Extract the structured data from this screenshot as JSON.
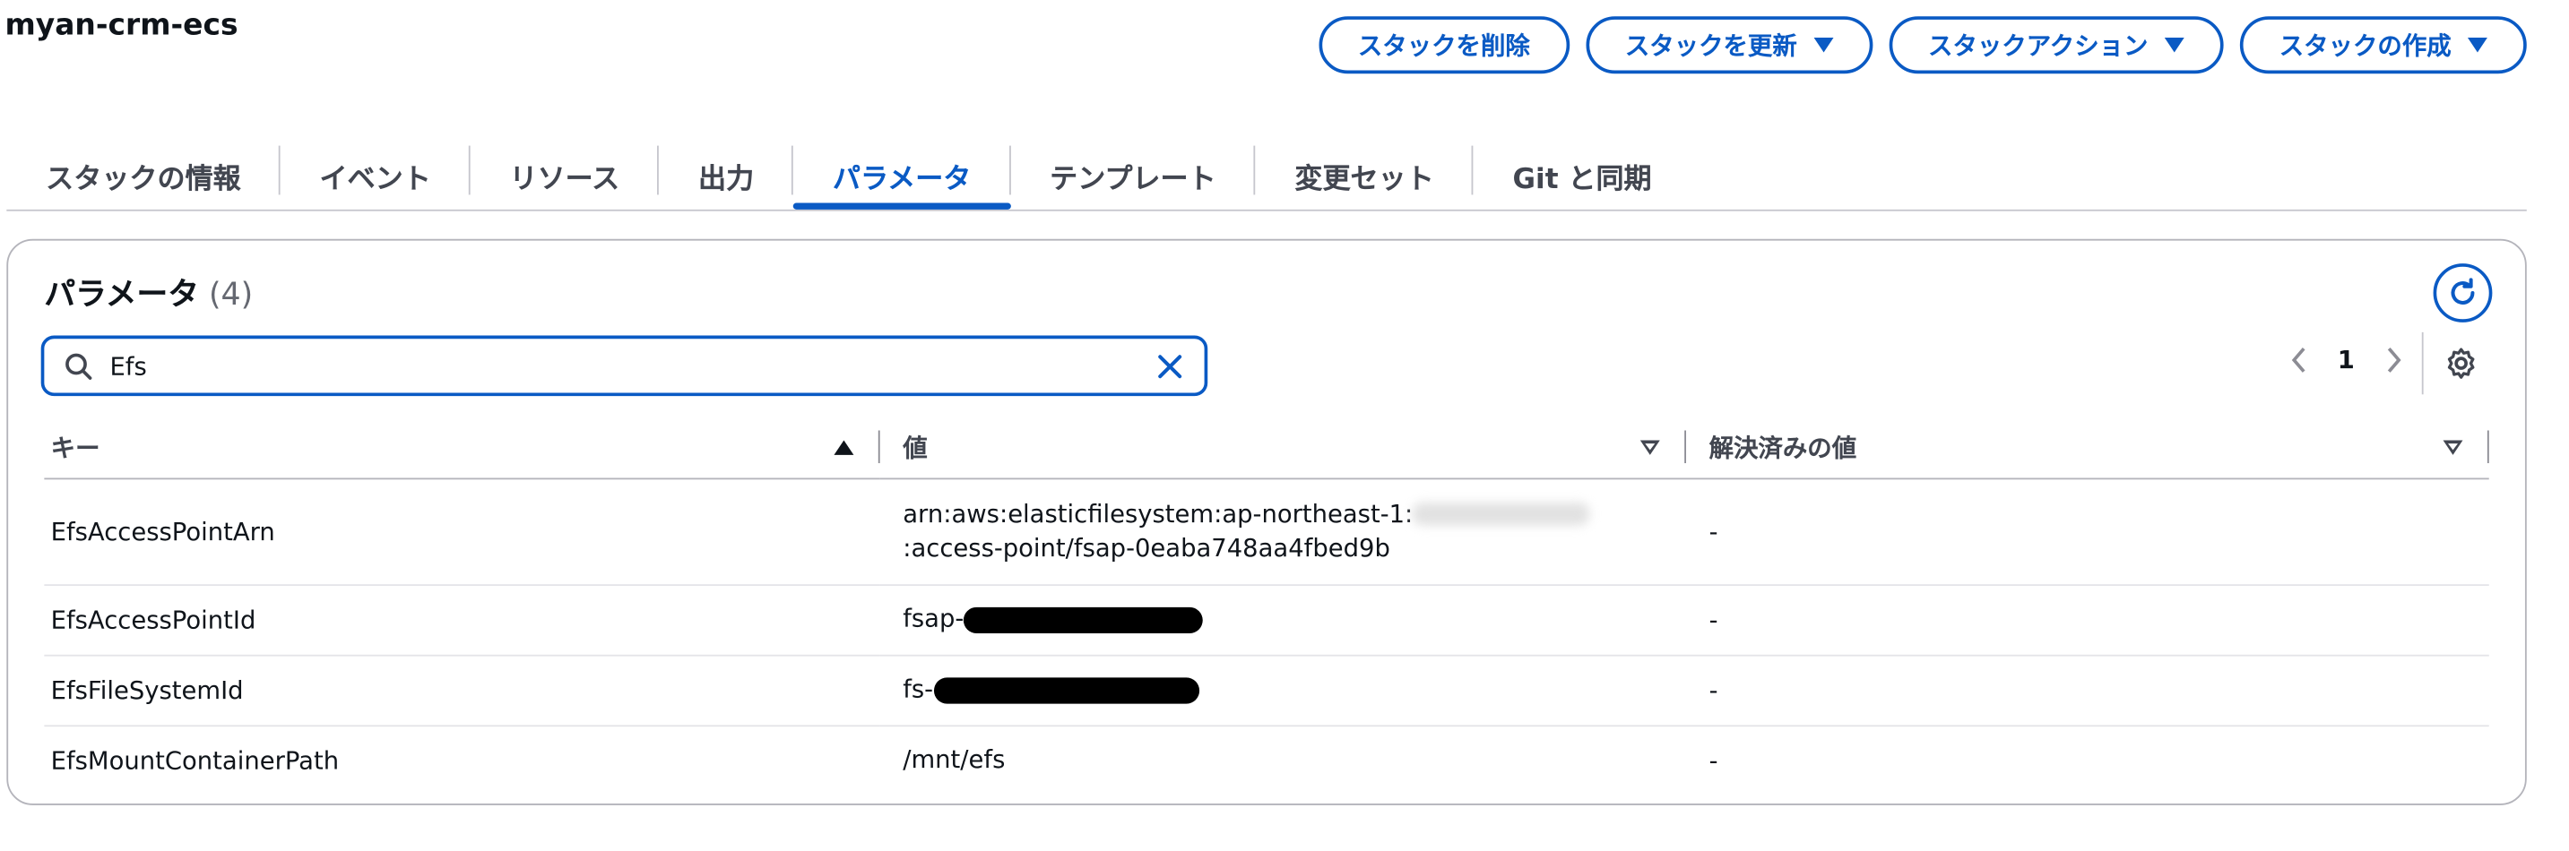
{
  "header": {
    "title": "myan-crm-ecs",
    "actions": [
      {
        "label": "スタックを削除",
        "dropdown": false
      },
      {
        "label": "スタックを更新",
        "dropdown": true
      },
      {
        "label": "スタックアクション",
        "dropdown": true
      },
      {
        "label": "スタックの作成",
        "dropdown": true
      }
    ]
  },
  "tabs": [
    {
      "label": "スタックの情報",
      "active": false
    },
    {
      "label": "イベント",
      "active": false
    },
    {
      "label": "リソース",
      "active": false
    },
    {
      "label": "出力",
      "active": false
    },
    {
      "label": "パラメータ",
      "active": true
    },
    {
      "label": "テンプレート",
      "active": false
    },
    {
      "label": "変更セット",
      "active": false
    },
    {
      "label": "Git と同期",
      "active": false
    }
  ],
  "panel": {
    "title": "パラメータ",
    "count": "(4)",
    "search_value": "Efs",
    "page_number": "1",
    "columns": {
      "key": "キー",
      "value": "値",
      "resolved": "解決済みの値"
    },
    "rows": [
      {
        "key": "EfsAccessPointArn",
        "value_prefix": "arn:aws:elasticfilesystem:ap-northeast-1:",
        "value_suffix": ":access-point/fsap-0eaba748aa4fbed9b",
        "resolved": "-"
      },
      {
        "key": "EfsAccessPointId",
        "value_prefix": "fsap-",
        "resolved": "-"
      },
      {
        "key": "EfsFileSystemId",
        "value_prefix": "fs-",
        "resolved": "-"
      },
      {
        "key": "EfsMountContainerPath",
        "value_prefix": "/mnt/efs",
        "resolved": "-"
      }
    ]
  },
  "colors": {
    "accent": "#0a5ac4",
    "text": "#0f141a",
    "muted": "#424650",
    "border": "#b4b4bb"
  }
}
